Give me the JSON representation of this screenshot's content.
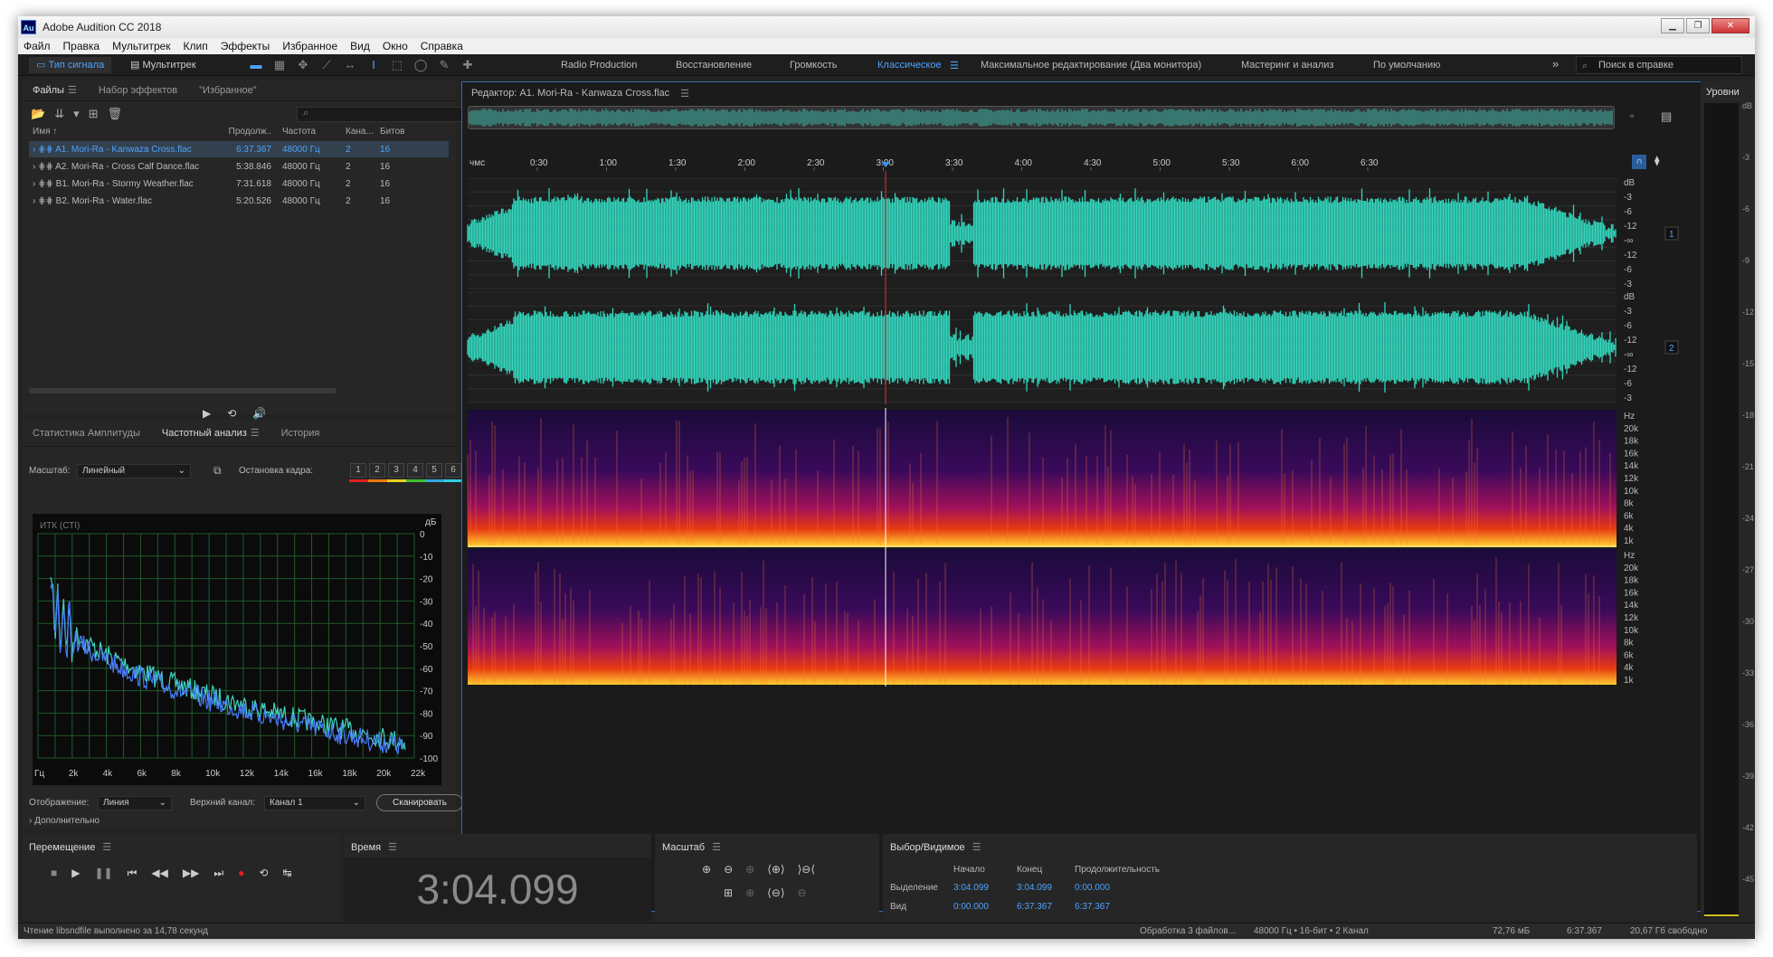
{
  "app": {
    "title": "Adobe Audition CC 2018",
    "icon": "Au"
  },
  "menu": [
    "Файл",
    "Правка",
    "Мультитрек",
    "Клип",
    "Эффекты",
    "Избранное",
    "Вид",
    "Окно",
    "Справка"
  ],
  "modes": {
    "waveform": "Тип сигнала",
    "multitrack": "Мультитрек"
  },
  "workspaces": [
    "Radio Production",
    "Восстановление",
    "Громкость",
    "Классическое",
    "Максимальное редактирование (Два монитора)",
    "Мастеринг и анализ",
    "По умолчанию"
  ],
  "active_workspace": "Классическое",
  "search": {
    "placeholder": "Поиск в справке"
  },
  "files_panel": {
    "tabs": [
      "Файлы",
      "Набор эффектов",
      "\"Избранное\""
    ],
    "columns": [
      "Имя",
      "Продолж..",
      "Частота",
      "Кана...",
      "Битов"
    ],
    "rows": [
      {
        "name": "A1. Mori-Ra - Kanwaza Cross.flac",
        "dur": "6:37.367",
        "rate": "48000 Гц",
        "ch": "2",
        "bits": "16"
      },
      {
        "name": "A2. Mori-Ra - Cross Calf Dance.flac",
        "dur": "5:38.846",
        "rate": "48000 Гц",
        "ch": "2",
        "bits": "16"
      },
      {
        "name": "B1. Mori-Ra - Stormy Weather.flac",
        "dur": "7:31.618",
        "rate": "48000 Гц",
        "ch": "2",
        "bits": "16"
      },
      {
        "name": "B2. Mori-Ra - Water.flac",
        "dur": "5:20.526",
        "rate": "48000 Гц",
        "ch": "2",
        "bits": "16"
      }
    ]
  },
  "analysis_panel": {
    "tabs": [
      "Статистика Амплитуды",
      "Частотный анализ",
      "История"
    ],
    "scale_label": "Масштаб:",
    "scale_value": "Линейный",
    "freeze_label": "Остановка кадра:",
    "channels": [
      "1",
      "2",
      "3",
      "4",
      "5",
      "6"
    ],
    "channel_colors": [
      "#e02020",
      "#f07a10",
      "#e8d020",
      "#40c030",
      "#30a8e0",
      "#30d0e0"
    ],
    "plot_label": "ИТК (СТІ)",
    "y_unit": "дБ",
    "y_ticks": [
      "0",
      "-10",
      "-20",
      "-30",
      "-40",
      "-50",
      "-60",
      "-70",
      "-80",
      "-90",
      "-100"
    ],
    "x_ticks": [
      "Гц",
      "2k",
      "4k",
      "6k",
      "8k",
      "10k",
      "12k",
      "14k",
      "16k",
      "18k",
      "20k",
      "22k"
    ],
    "display_label": "Отображение:",
    "display_value": "Линия",
    "top_channel_label": "Верхний канал:",
    "top_channel_value": "Канал 1",
    "scan_button": "Сканировать",
    "advanced_label": "Дополнительно"
  },
  "editor": {
    "title": "Редактор: A1. Mori-Ra - Kanwaza Cross.flac",
    "ruler_unit": "чмс",
    "ruler_ticks": [
      "0:30",
      "1:00",
      "1:30",
      "2:00",
      "2:30",
      "3:00",
      "3:30",
      "4:00",
      "4:30",
      "5:00",
      "5:30",
      "6:00",
      "6:30"
    ],
    "db_labels": [
      "dB",
      "-3",
      "-6",
      "-12",
      "-∞",
      "-12",
      "-6",
      "-3"
    ],
    "hz_labels": [
      "Hz",
      "20k",
      "18k",
      "16k",
      "14k",
      "12k",
      "10k",
      "8k",
      "6k",
      "4k",
      "1k"
    ],
    "channel_badges": [
      "1",
      "2"
    ],
    "waveform_color": "#32d6bd"
  },
  "levels": {
    "title": "Уровни",
    "ticks": [
      "dB",
      "-3",
      "-6",
      "-9",
      "-12",
      "-15",
      "-18",
      "-21",
      "-24",
      "-27",
      "-30",
      "-33",
      "-36",
      "-39",
      "-42",
      "-45",
      "-48"
    ]
  },
  "transport": {
    "title": "Перемещение"
  },
  "time": {
    "title": "Время",
    "value": "3:04.099"
  },
  "zoom": {
    "title": "Масштаб"
  },
  "selection": {
    "title": "Выбор/Видимое",
    "headers": [
      "Начало",
      "Конец",
      "Продолжительность"
    ],
    "rows": [
      {
        "label": "Выделение",
        "start": "3:04.099",
        "end": "3:04.099",
        "dur": "0:00.000"
      },
      {
        "label": "Вид",
        "start": "0:00.000",
        "end": "6:37.367",
        "dur": "6:37.367"
      }
    ]
  },
  "status": {
    "left": "Чтение libsndfile выполнено за 14,78 секунд",
    "processing": "Обработка 3 файлов...",
    "format": "48000 Гц • 16-бит • 2 Канал",
    "size": "72,76 мБ",
    "duration": "6:37.367",
    "free": "20,67 Гб свободно"
  }
}
